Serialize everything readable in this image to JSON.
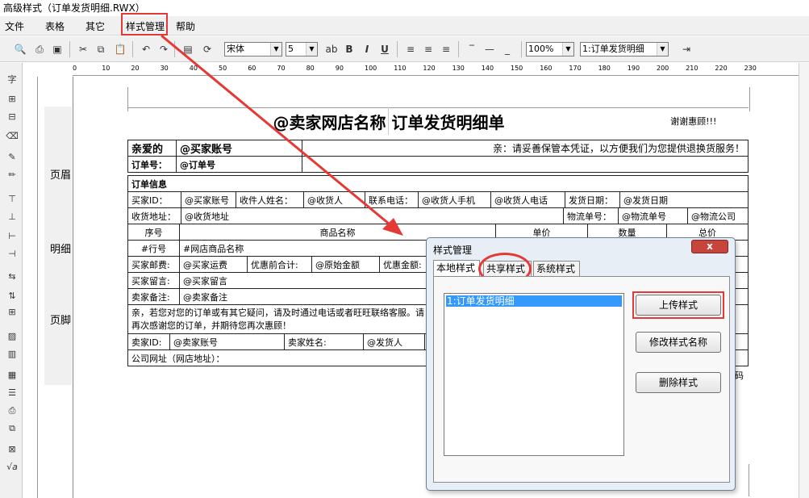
{
  "window": {
    "title": "高级样式（订单发货明细.RWX）"
  },
  "menu": {
    "file": "文件",
    "table": "表格",
    "other": "其它",
    "style_manage": "样式管理",
    "help": "帮助"
  },
  "toolbar": {
    "font": "宋体",
    "font_size": "5",
    "zoom": "100%",
    "style_select": "1:订单发货明细",
    "bold": "B",
    "italic": "I",
    "underline": "U"
  },
  "ruler": {
    "marks": [
      "0",
      "10",
      "20",
      "30",
      "40",
      "50",
      "60",
      "70",
      "80",
      "90",
      "100",
      "110",
      "120",
      "130",
      "140",
      "150",
      "160",
      "170",
      "180",
      "190",
      "200",
      "210",
      "220",
      "230"
    ]
  },
  "bands": {
    "header": "页眉",
    "detail": "明细",
    "footer": "页脚"
  },
  "report": {
    "shop_title": "@卖家网店名称",
    "sheet_title": "订单发货明细单",
    "thanks": "谢谢惠顾!!!",
    "dear": "亲爱的",
    "buyer_account": "@买家账号",
    "notice": "亲：请妥善保管本凭证，以方便我们为您提供退换货服务！",
    "order_no_label": "订单号：",
    "order_no": "@订单号",
    "order_info": "订单信息",
    "row1": [
      "买家ID：",
      "@买家账号",
      "收件人姓名：",
      "@收货人",
      "联系电话：",
      "@收货人手机",
      "@收货人电话",
      "发货日期：",
      "@发货日期"
    ],
    "row2": [
      "收货地址：",
      "@收货地址",
      "物流单号：",
      "@物流单号",
      "@物流公司"
    ],
    "cols": [
      "序号",
      "商品名称",
      "单价",
      "数量",
      "总价"
    ],
    "detail": [
      "#行号",
      "#网店商品名称"
    ],
    "row3": [
      "买家邮费:",
      "@买家运费",
      "优惠前合计:",
      "@原始金额",
      "优惠金额:"
    ],
    "row4": [
      "买家留言:",
      "@买家留言"
    ],
    "row5": [
      "卖家备注:",
      "@卖家备注"
    ],
    "message1": "亲，若您对您的订单或有其它疑问，请及时通过电话或者旺旺联络客服。请",
    "message2": "再次感谢您的订单，并期待您再次惠顾！",
    "row6": [
      "卖家ID:",
      "@卖家账号",
      "卖家姓名:",
      "@发货人"
    ],
    "company": "公司网址（网店地址）：",
    "tail": "码"
  },
  "dialog": {
    "title": "样式管理",
    "close": "x",
    "tabs": [
      "本地样式",
      "共享样式",
      "系统样式"
    ],
    "list_items": [
      "1:订单发货明细"
    ],
    "upload": "上传样式",
    "rename": "修改样式名称",
    "delete": "删除样式"
  },
  "colors": {
    "highlight": "#e53935",
    "selection": "#3399ff",
    "close": "#c9443a"
  }
}
